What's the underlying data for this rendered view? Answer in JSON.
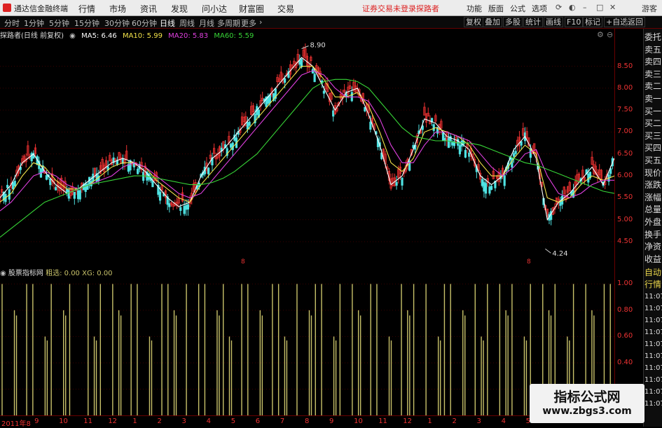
{
  "app": {
    "title": "通达信金融终端",
    "menu": [
      "行情",
      "市场",
      "资讯",
      "发现",
      "问小达",
      "财富圈",
      "交易"
    ],
    "warning": "证券交易未登录",
    "user_link": "探路者",
    "right_menu": [
      "功能",
      "版面",
      "公式",
      "选项"
    ],
    "guest_label": "游客"
  },
  "toolbar": {
    "periods": [
      "分时",
      "1分钟",
      "5分钟",
      "15分钟",
      "30分钟",
      "60分钟",
      "日线",
      "周线",
      "月线",
      "多周期",
      "更多"
    ],
    "active_period": "日线",
    "right_buttons": [
      "复权",
      "叠加",
      "多股",
      "统计",
      "画线",
      "F10",
      "标记",
      "+自选",
      "返回"
    ]
  },
  "chart_info": {
    "stock_label": "探路者(日线 前复权)",
    "ma5": "MA5: 6.46",
    "ma10": "MA10: 5.99",
    "ma20": "MA20: 5.83",
    "ma60": "MA60: 5.59",
    "colors": {
      "ma5": "#ffffff",
      "ma10": "#f2e24a",
      "ma20": "#e040e0",
      "ma60": "#37d437",
      "up": "#e83030",
      "down": "#4fe2e2",
      "indicator": "#c8c26a"
    }
  },
  "indicator_info": {
    "name": "股票指标网",
    "coarse": "粗选: 0.00",
    "xg": "XG: 0.00"
  },
  "side_panel": {
    "items": [
      "委托",
      "卖五",
      "卖四",
      "卖三",
      "卖二",
      "卖一",
      "买一",
      "买二",
      "买三",
      "买四",
      "买五",
      "现价",
      "涨跌",
      "涨幅",
      "总量",
      "外盘",
      "换手",
      "净资",
      "收益"
    ],
    "auto_label": "自动",
    "quote_label": "行情",
    "times": [
      "11:07",
      "11:07",
      "11:07",
      "11:07",
      "11:07",
      "11:07",
      "11:07",
      "11:07",
      "11:07",
      "11:07"
    ]
  },
  "chart_data": [
    {
      "type": "candlestick",
      "y_axis_ticks": [
        "8.50",
        "8.00",
        "7.50",
        "7.00",
        "6.50",
        "6.00",
        "5.50",
        "5.00",
        "4.50"
      ],
      "ylim": [
        4.1,
        9.1
      ],
      "annotations": {
        "high_label": "8.90",
        "low_label": "4.24"
      },
      "marker_labels": [
        "8",
        "8"
      ],
      "series": [
        {
          "name": "MA5",
          "values": [
            5.5,
            5.8,
            6.3,
            6.5,
            6.1,
            5.8,
            5.6,
            5.7,
            5.9,
            6.1,
            6.3,
            6.4,
            6.3,
            6.1,
            5.8,
            5.5,
            5.3,
            5.4,
            6.0,
            6.4,
            6.6,
            6.9,
            7.2,
            7.5,
            7.8,
            8.1,
            8.4,
            8.7,
            8.5,
            8.0,
            7.5,
            7.9,
            8.0,
            7.4,
            6.7,
            5.8,
            6.0,
            6.6,
            7.3,
            7.2,
            6.9,
            6.8,
            6.6,
            6.0,
            5.8,
            6.0,
            6.6,
            6.9,
            6.4,
            5.0,
            5.4,
            5.6,
            5.9,
            6.2,
            5.8,
            6.4
          ]
        },
        {
          "name": "MA10",
          "values": [
            5.4,
            5.6,
            6.0,
            6.3,
            6.2,
            5.9,
            5.7,
            5.7,
            5.8,
            6.0,
            6.2,
            6.3,
            6.3,
            6.2,
            5.9,
            5.7,
            5.5,
            5.4,
            5.8,
            6.1,
            6.4,
            6.7,
            7.0,
            7.3,
            7.6,
            7.9,
            8.2,
            8.5,
            8.5,
            8.2,
            7.8,
            7.8,
            7.9,
            7.6,
            7.0,
            6.3,
            6.1,
            6.4,
            7.0,
            7.1,
            7.0,
            6.9,
            6.7,
            6.3,
            6.0,
            6.0,
            6.4,
            6.7,
            6.5,
            5.5,
            5.4,
            5.5,
            5.8,
            6.0,
            5.9,
            6.0
          ]
        },
        {
          "name": "MA20",
          "values": [
            5.2,
            5.4,
            5.7,
            6.0,
            6.1,
            6.0,
            5.8,
            5.7,
            5.8,
            5.9,
            6.0,
            6.2,
            6.3,
            6.2,
            6.0,
            5.8,
            5.6,
            5.5,
            5.6,
            5.9,
            6.2,
            6.5,
            6.8,
            7.1,
            7.4,
            7.7,
            8.0,
            8.3,
            8.4,
            8.3,
            8.0,
            7.8,
            7.8,
            7.7,
            7.3,
            6.7,
            6.3,
            6.3,
            6.7,
            7.0,
            7.0,
            6.9,
            6.8,
            6.5,
            6.2,
            6.0,
            6.2,
            6.5,
            6.6,
            6.0,
            5.6,
            5.5,
            5.6,
            5.8,
            5.9,
            5.9
          ]
        },
        {
          "name": "MA60",
          "values": [
            4.6,
            4.8,
            5.0,
            5.2,
            5.4,
            5.5,
            5.6,
            5.7,
            5.8,
            5.85,
            5.9,
            5.95,
            6.0,
            6.0,
            5.95,
            5.9,
            5.85,
            5.8,
            5.8,
            5.85,
            5.95,
            6.1,
            6.3,
            6.5,
            6.8,
            7.1,
            7.4,
            7.7,
            8.0,
            8.15,
            8.2,
            8.2,
            8.15,
            8.0,
            7.7,
            7.4,
            7.1,
            6.9,
            6.85,
            6.8,
            6.8,
            6.75,
            6.75,
            6.7,
            6.6,
            6.5,
            6.4,
            6.3,
            6.25,
            6.15,
            6.05,
            5.95,
            5.85,
            5.75,
            5.65,
            5.6
          ]
        }
      ]
    },
    {
      "type": "bar",
      "y_axis_ticks": [
        "1.00",
        "0.80",
        "0.60",
        "0.40",
        "0.20"
      ],
      "ylim": [
        0,
        1.05
      ],
      "values": [
        1,
        0,
        0.8,
        0,
        1,
        1,
        0,
        0.6,
        1,
        0,
        0.8,
        1,
        0,
        0,
        1,
        0.6,
        1,
        0,
        1,
        0.8,
        0,
        1,
        1,
        0,
        0.6,
        0,
        1,
        1,
        0.8,
        0,
        1,
        0,
        1,
        1,
        0,
        0.8,
        1,
        0.6,
        0,
        1,
        1,
        0,
        0.8,
        0,
        1,
        1,
        0.6,
        0,
        1,
        0,
        0.8,
        1,
        1,
        0,
        0.6,
        1,
        0,
        1,
        0.8,
        0,
        1,
        1,
        0,
        0.6,
        0,
        1,
        0.8,
        1,
        0,
        1,
        0,
        0.6,
        1,
        1,
        0,
        0.8,
        0,
        1,
        0.6,
        1,
        0,
        1,
        0.8,
        1,
        0,
        0.6,
        1,
        0,
        1,
        0.8,
        1,
        0,
        0.6,
        1,
        0,
        1,
        0.8,
        0,
        1,
        1
      ]
    }
  ],
  "date_axis": [
    "2011年8",
    "9",
    "10",
    "11",
    "12",
    "1",
    "2",
    "3",
    "4",
    "5",
    "6",
    "7",
    "8",
    "9",
    "10",
    "11",
    "12",
    "1",
    "2",
    "3",
    "4",
    "5",
    "6",
    "7",
    "8"
  ],
  "watermark": {
    "line1": "指标公式网",
    "line2": "www.zbgs3.com"
  }
}
